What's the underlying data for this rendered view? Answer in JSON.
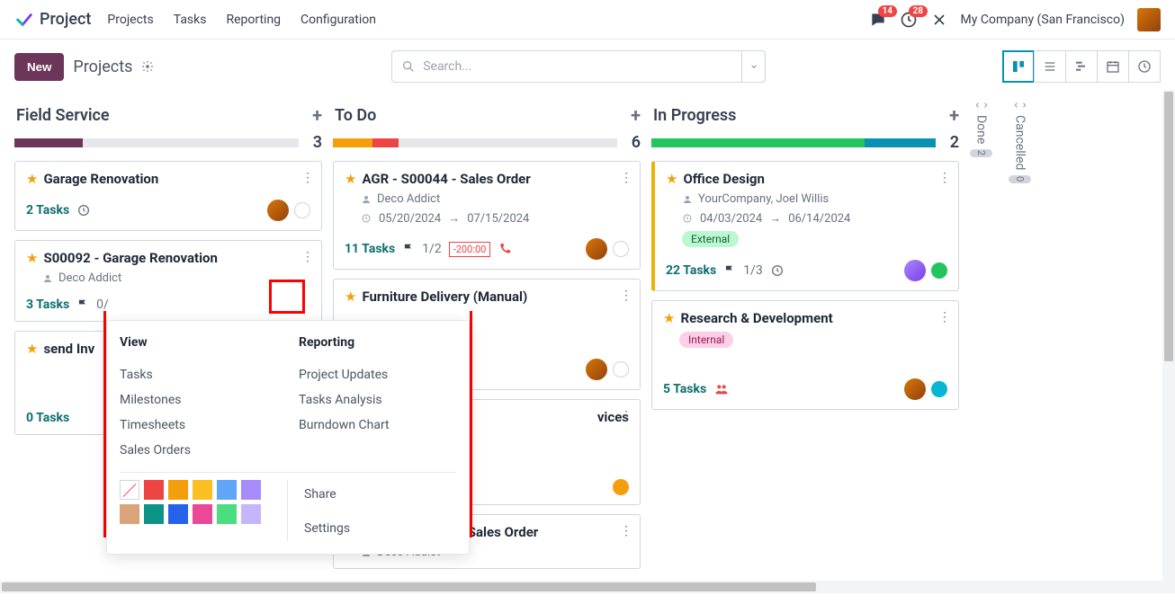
{
  "header": {
    "brand": "Project",
    "menu": [
      "Projects",
      "Tasks",
      "Reporting",
      "Configuration"
    ],
    "chat_badge": "14",
    "activity_badge": "28",
    "company": "My Company (San Francisco)"
  },
  "controlbar": {
    "new_label": "New",
    "breadcrumb": "Projects",
    "search_placeholder": "Search..."
  },
  "columns": [
    {
      "title": "Field Service",
      "count": "3",
      "progress": [
        {
          "color": "#6b3659",
          "pct": 24
        }
      ],
      "cards": [
        {
          "star": true,
          "title": "Garage Renovation",
          "tasks": "2 Tasks",
          "clock": true,
          "avatar": "brown",
          "dot": "empty"
        },
        {
          "star": true,
          "title": "S00092 - Garage Renovation",
          "client": "Deco Addict",
          "tasks": "3 Tasks",
          "flag": "0/",
          "menu_active": true
        },
        {
          "star": true,
          "title": "send Inv",
          "tasks": "0 Tasks"
        }
      ]
    },
    {
      "title": "To Do",
      "count": "6",
      "progress": [
        {
          "color": "#f59e0b",
          "pct": 14
        },
        {
          "color": "#ef4444",
          "pct": 9
        }
      ],
      "cards": [
        {
          "star": true,
          "title": "AGR - S00044 - Sales Order",
          "client": "Deco Addict",
          "date_from": "05/20/2024",
          "date_to": "07/15/2024",
          "tasks": "11 Tasks",
          "flag": "1/2",
          "time": "-200:00",
          "phone": true,
          "avatar": "brown",
          "dot": "empty"
        },
        {
          "star": true,
          "title": "Furniture Delivery (Manual)",
          "tasks_only_avatar": true,
          "avatar": "brown",
          "dot": "empty"
        },
        {
          "star": true,
          "title_partial": "vices",
          "dot": "orange"
        },
        {
          "star": false,
          "title": "DECO - S00046 - Sales Order",
          "client": "Deco Addict"
        }
      ]
    },
    {
      "title": "In Progress",
      "count": "2",
      "progress": [
        {
          "color": "#22c55e",
          "pct": 75
        },
        {
          "color": "#0891b2",
          "pct": 25
        }
      ],
      "cards": [
        {
          "star": true,
          "accent": true,
          "title": "Office Design",
          "client": "YourCompany, Joel Willis",
          "date_from": "04/03/2024",
          "date_to": "06/14/2024",
          "tag": {
            "text": "External",
            "cls": "external"
          },
          "tasks": "22 Tasks",
          "flag": "1/3",
          "clock": true,
          "avatar": "purple",
          "dot": "green"
        },
        {
          "star": true,
          "title": "Research & Development",
          "tag": {
            "text": "Internal",
            "cls": "internal"
          },
          "tasks": "5 Tasks",
          "people": true,
          "avatar": "brown",
          "dot": "teal"
        }
      ]
    }
  ],
  "collapsed": [
    {
      "title": "Done",
      "count": "2"
    },
    {
      "title": "Cancelled",
      "count": "0"
    }
  ],
  "popover": {
    "view_h": "View",
    "reporting_h": "Reporting",
    "view_items": [
      "Tasks",
      "Milestones",
      "Timesheets",
      "Sales Orders"
    ],
    "reporting_items": [
      "Project Updates",
      "Tasks Analysis",
      "Burndown Chart"
    ],
    "colors": [
      "none",
      "#ef4444",
      "#f59e0b",
      "#fbbf24",
      "#60a5fa",
      "#a78bfa",
      "#d9a47a",
      "#0d9488",
      "#2563eb",
      "#ec4899",
      "#4ade80",
      "#c4b5fd"
    ],
    "actions": [
      "Share",
      "Settings"
    ]
  }
}
